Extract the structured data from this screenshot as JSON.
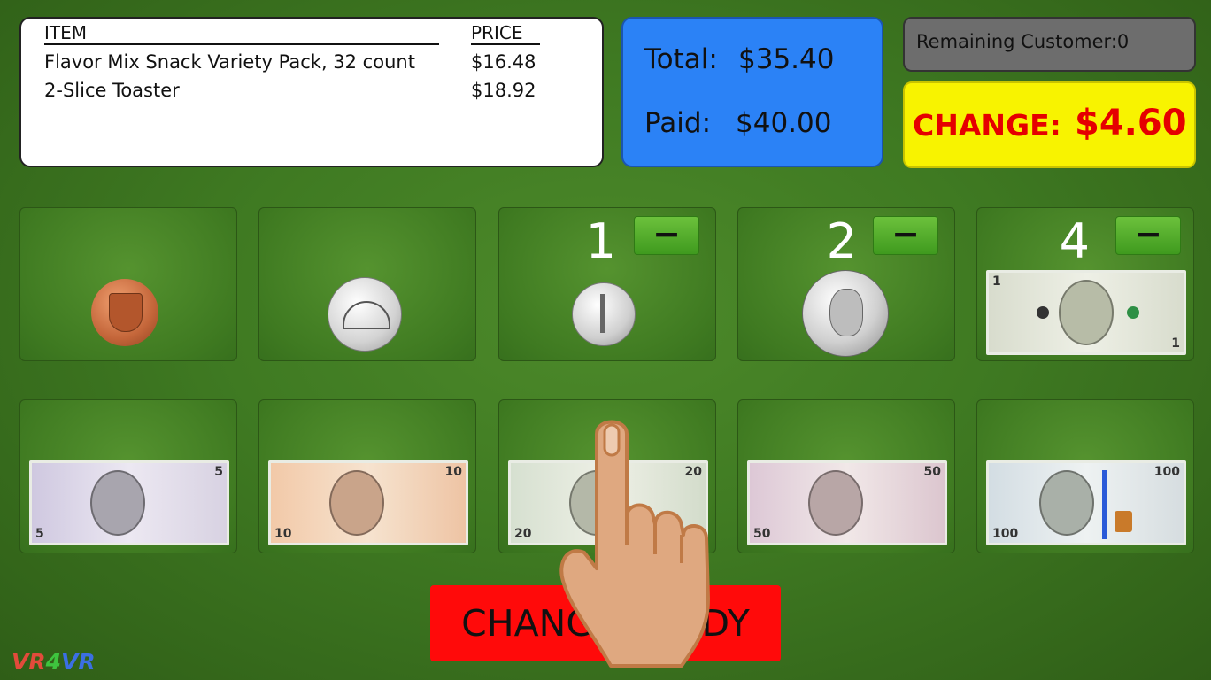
{
  "receipt": {
    "header_item": "ITEM",
    "header_price": "PRICE",
    "items": [
      {
        "name": "Flavor Mix Snack Variety Pack, 32 count",
        "price": "$16.48"
      },
      {
        "name": "2-Slice Toaster",
        "price": "$18.92"
      }
    ]
  },
  "totals": {
    "total_label": "Total:",
    "total_value": "$35.40",
    "paid_label": "Paid:",
    "paid_value": "$40.00"
  },
  "remaining": {
    "text": "Remaining Customer:0"
  },
  "change": {
    "label": "CHANGE:",
    "value": "$4.60"
  },
  "tray": {
    "penny": {
      "count": null,
      "name": "penny"
    },
    "nickel": {
      "count": null,
      "name": "nickel"
    },
    "dime": {
      "count": "1",
      "minus": "−"
    },
    "quarter": {
      "count": "2",
      "minus": "−"
    },
    "one_dollar": {
      "count": "4",
      "minus": "−"
    },
    "five_dollar": {
      "den": "5"
    },
    "ten_dollar": {
      "den": "10"
    },
    "twenty_dollar": {
      "den": "20"
    },
    "fifty_dollar": {
      "den": "50"
    },
    "hundred_dollar": {
      "den": "100"
    }
  },
  "ready_button": {
    "label": "CHANGE READY"
  },
  "logo": {
    "v": "VR",
    "four": "4",
    "v2": "VR"
  },
  "colors": {
    "felt": "#3f7a22",
    "total_panel": "#2b82f6",
    "change_panel": "#f8f300",
    "change_text": "#e50000",
    "ready_button": "#ff0a0a"
  }
}
